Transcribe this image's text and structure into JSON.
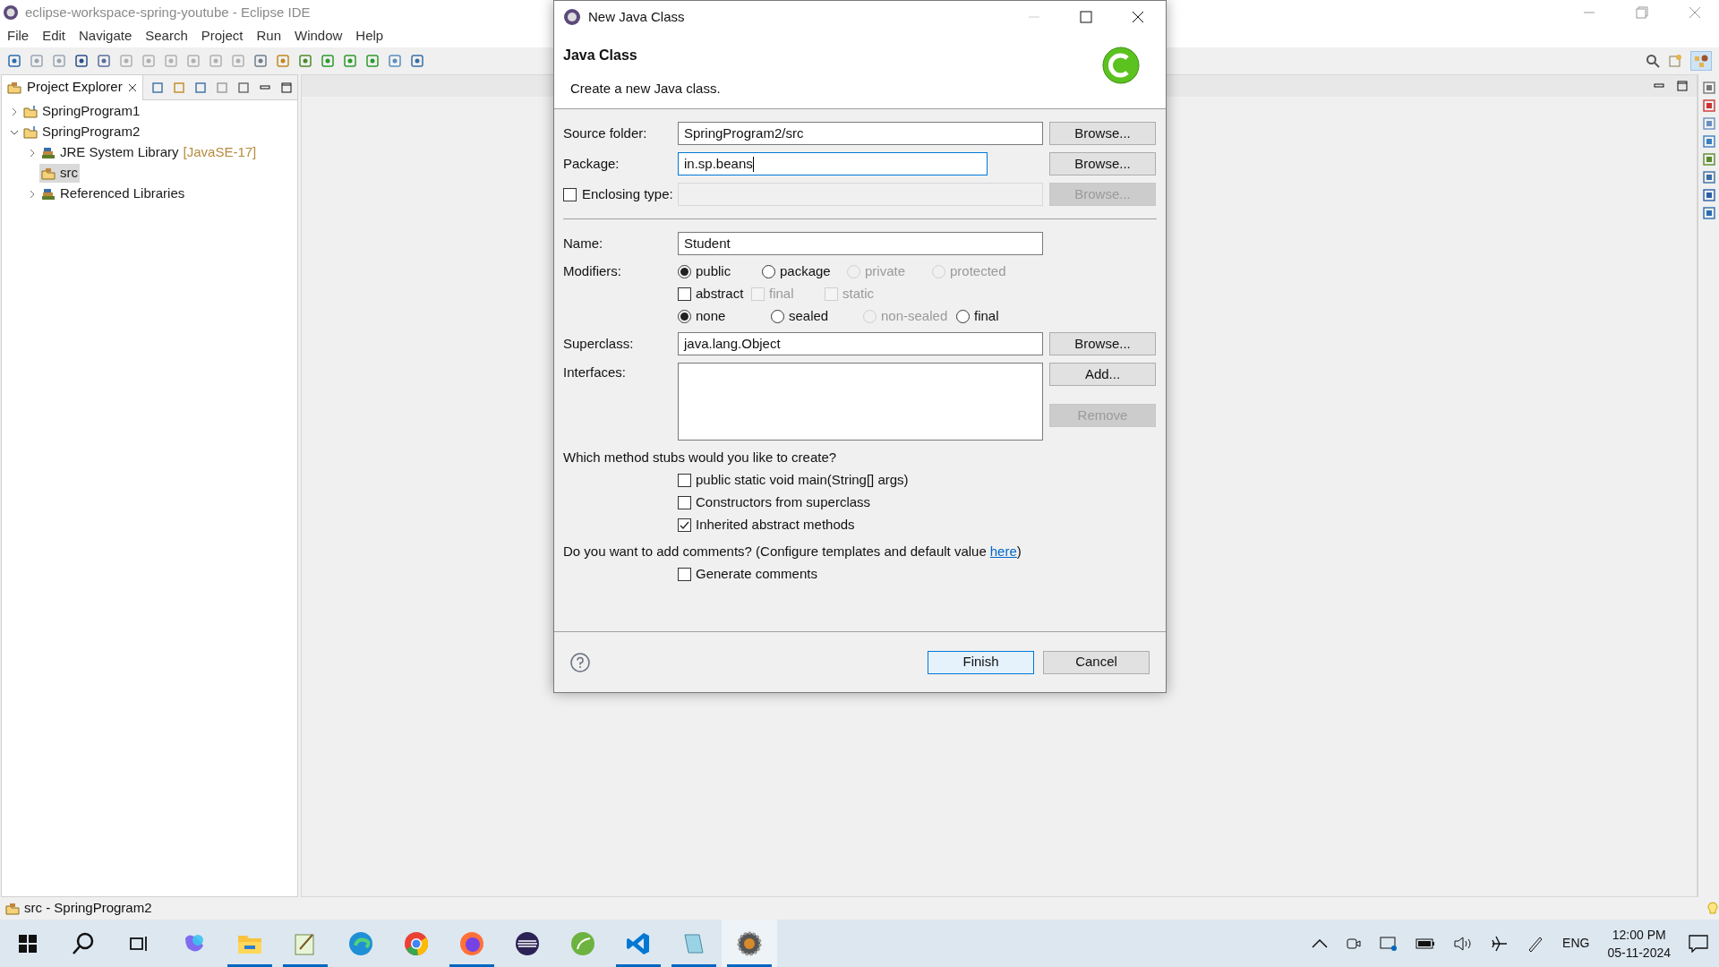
{
  "window": {
    "title": "eclipse-workspace-spring-youtube - Eclipse IDE"
  },
  "menu": [
    "File",
    "Edit",
    "Navigate",
    "Search",
    "Project",
    "Run",
    "Window",
    "Help"
  ],
  "project_explorer": {
    "title": "Project Explorer",
    "tree": [
      {
        "label": "SpringProgram1",
        "kind": "project",
        "expanded": false,
        "selected": false
      },
      {
        "label": "SpringProgram2",
        "kind": "project",
        "expanded": true,
        "selected": false,
        "children": [
          {
            "label": "JRE System Library",
            "suffix": "[JavaSE-17]",
            "kind": "library",
            "expanded": false,
            "selected": false
          },
          {
            "label": "src",
            "kind": "folder",
            "selected": true
          },
          {
            "label": "Referenced Libraries",
            "kind": "library",
            "expanded": false,
            "selected": false
          }
        ]
      }
    ]
  },
  "status_bar": {
    "text": "src - SpringProgram2"
  },
  "dialog": {
    "title": "New Java Class",
    "heading": "Java Class",
    "description": "Create a new Java class.",
    "source_folder": {
      "label": "Source folder:",
      "value": "SpringProgram2/src",
      "button": "Browse...",
      "button_disabled": false
    },
    "package": {
      "label": "Package:",
      "value": "in.sp.beans",
      "focused": true,
      "button": "Browse...",
      "button_disabled": false
    },
    "enclosing_type": {
      "label": "Enclosing type:",
      "checked": false,
      "button": "Browse...",
      "button_disabled": true
    },
    "name": {
      "label": "Name:",
      "value": "Student"
    },
    "modifiers": {
      "label": "Modifiers:",
      "access": [
        {
          "label": "public",
          "selected": true,
          "disabled": false
        },
        {
          "label": "package",
          "selected": false,
          "disabled": false
        },
        {
          "label": "private",
          "selected": false,
          "disabled": true
        },
        {
          "label": "protected",
          "selected": false,
          "disabled": true
        }
      ],
      "flags": [
        {
          "label": "abstract",
          "checked": false,
          "disabled": false
        },
        {
          "label": "final",
          "checked": false,
          "disabled": true
        },
        {
          "label": "static",
          "checked": false,
          "disabled": true
        }
      ],
      "sealing": [
        {
          "label": "none",
          "selected": true,
          "disabled": false
        },
        {
          "label": "sealed",
          "selected": false,
          "disabled": false
        },
        {
          "label": "non-sealed",
          "selected": false,
          "disabled": true
        },
        {
          "label": "final",
          "selected": false,
          "disabled": false
        }
      ]
    },
    "superclass": {
      "label": "Superclass:",
      "value": "java.lang.Object",
      "button": "Browse...",
      "button_disabled": false
    },
    "interfaces": {
      "label": "Interfaces:",
      "buttons": [
        {
          "label": "Add...",
          "disabled": false
        },
        {
          "label": "Remove",
          "disabled": true
        }
      ]
    },
    "stubs_question": "Which method stubs would you like to create?",
    "stubs": [
      {
        "label": "public static void main(String[] args)",
        "checked": false
      },
      {
        "label": "Constructors from superclass",
        "checked": false
      },
      {
        "label": "Inherited abstract methods",
        "checked": true
      }
    ],
    "comments_question": "Do you want to add comments? (Configure templates and default value",
    "comments_link": "here",
    "comments_close": ")",
    "generate_comments": {
      "label": "Generate comments",
      "checked": false
    },
    "buttons": [
      {
        "label": "Finish",
        "default": true
      },
      {
        "label": "Cancel",
        "default": false
      }
    ]
  },
  "taskbar": {
    "language": "ENG",
    "time": "12:00 PM",
    "date": "05-11-2024"
  }
}
